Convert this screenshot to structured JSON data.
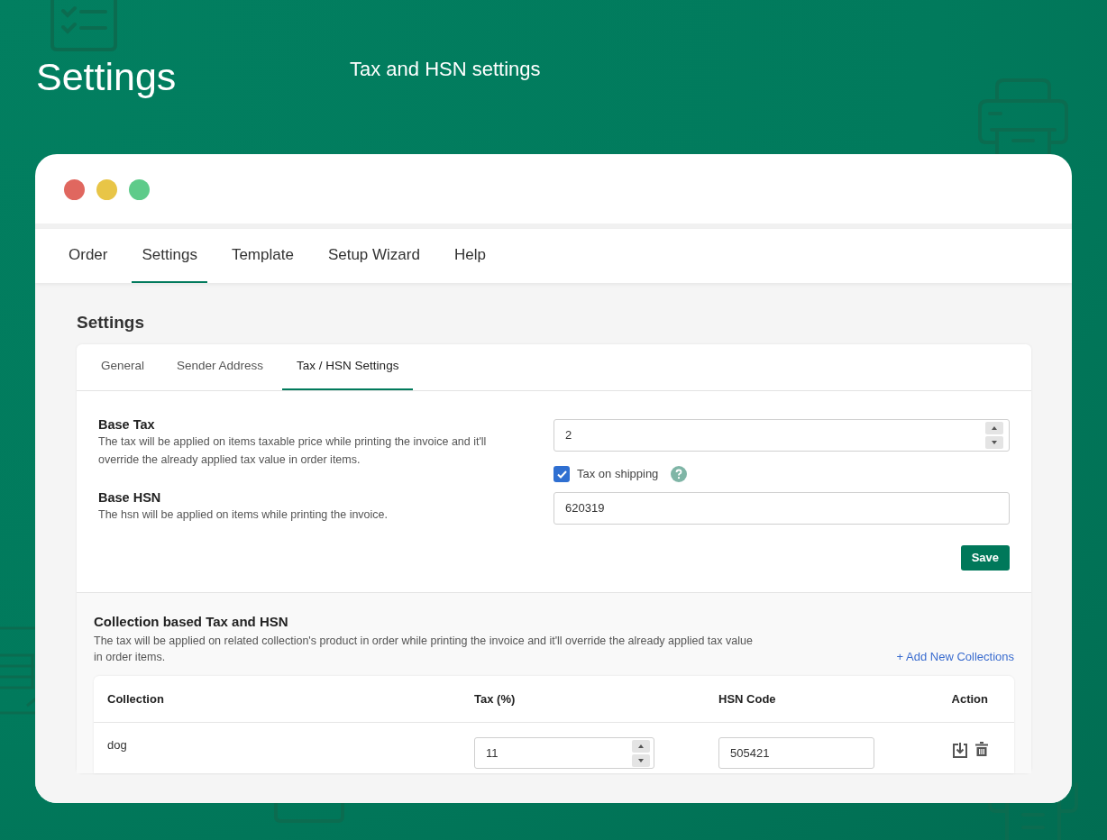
{
  "header": {
    "title": "Settings",
    "subtitle": "Tax and HSN settings"
  },
  "window_controls": [
    {
      "color": "#e0675f"
    },
    {
      "color": "#e8c547"
    },
    {
      "color": "#5ecb8a"
    }
  ],
  "nav_tabs": [
    {
      "label": "Order",
      "selected": false
    },
    {
      "label": "Settings",
      "selected": true
    },
    {
      "label": "Template",
      "selected": false
    },
    {
      "label": "Setup Wizard",
      "selected": false
    },
    {
      "label": "Help",
      "selected": false
    }
  ],
  "page_title": "Settings",
  "settings_tabs": [
    {
      "label": "General",
      "selected": false
    },
    {
      "label": "Sender Address",
      "selected": false
    },
    {
      "label": "Tax / HSN Settings",
      "selected": true
    }
  ],
  "base_tax": {
    "label": "Base Tax",
    "description": "The tax will be applied on items taxable price while printing the invoice and it'll override the already applied tax value in order items.",
    "value": "2"
  },
  "tax_on_shipping": {
    "label": "Tax on shipping",
    "checked": true
  },
  "base_hsn": {
    "label": "Base HSN",
    "description": "The hsn will be applied on items while printing the invoice.",
    "value": "620319"
  },
  "save_button": "Save",
  "collections": {
    "title": "Collection based Tax and HSN",
    "description": "The tax will be applied on related collection's product in order while printing the invoice and it'll override the already applied tax value in order items.",
    "add_link": "+ Add New Collections",
    "columns": [
      "Collection",
      "Tax (%)",
      "HSN Code",
      "Action"
    ],
    "rows": [
      {
        "collection": "dog",
        "tax": "11",
        "hsn_code": "505421"
      }
    ]
  }
}
